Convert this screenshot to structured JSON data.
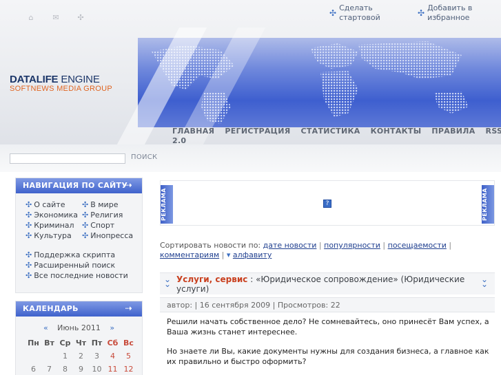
{
  "top_links": [
    {
      "label": "Сделать стартовой",
      "icon": "cross-icon"
    },
    {
      "label": "Добавить в избранное",
      "icon": "cross-icon"
    }
  ],
  "logo": {
    "brand": "DATALIFE",
    "engine": "ENGINE",
    "subtitle": "SOFTNEWS MEDIA GROUP"
  },
  "nav": [
    "ГЛАВНАЯ",
    "РЕГИСТРАЦИЯ",
    "СТАТИСТИКА",
    "КОНТАКТЫ",
    "ПРАВИЛА",
    "RSS 2.0"
  ],
  "search": {
    "button": "ПОИСК",
    "value": ""
  },
  "sidebar": {
    "nav_title": "НАВИГАЦИЯ ПО САЙТУ",
    "nav_items": [
      "О сайте",
      "В мире",
      "Экономика",
      "Религия",
      "Криминал",
      "Спорт",
      "Культура",
      "Инопресса"
    ],
    "extra_items": [
      "Поддержка скрипта",
      "Расширенный поиск",
      "Все последние новости"
    ],
    "calendar_title": "КАЛЕНДАРЬ",
    "calendar": {
      "month": "Июнь 2011",
      "prev": "«",
      "next": "»",
      "weekdays": [
        "Пн",
        "Вт",
        "Ср",
        "Чт",
        "Пт",
        "Сб",
        "Вс"
      ],
      "weeks": [
        [
          "",
          "",
          "1",
          "2",
          "3",
          "4",
          "5"
        ],
        [
          "6",
          "7",
          "8",
          "9",
          "10",
          "11",
          "12"
        ]
      ]
    }
  },
  "ad": {
    "label": "РЕКЛАМА",
    "icon": "?"
  },
  "sort": {
    "prefix": "Сортировать новости по:",
    "options": [
      "дате новости",
      "популярности",
      "посещаемости",
      "комментариям",
      "алфавиту"
    ],
    "alphabet_arrow": "▾"
  },
  "news": {
    "category": "Услуги, сервис",
    "separator": ":",
    "title": "«Юридическое сопровождение» (Юридические услуги)",
    "meta": "автор: | 16 сентября 2009 | Просмотров: 22",
    "paragraphs": [
      "Решили начать собственное дело? Не сомневайтесь, оно принесёт Вам успех, а Ваша жизнь станет интереснее.",
      "Но знаете ли Вы, какие документы нужны для создания бизнеса, а главное как их правильно и быстро оформить?"
    ]
  },
  "colors": {
    "accent": "#3f62cc",
    "category": "#c9401f",
    "link": "#1f3f8f",
    "logo_orange": "#e06420"
  }
}
